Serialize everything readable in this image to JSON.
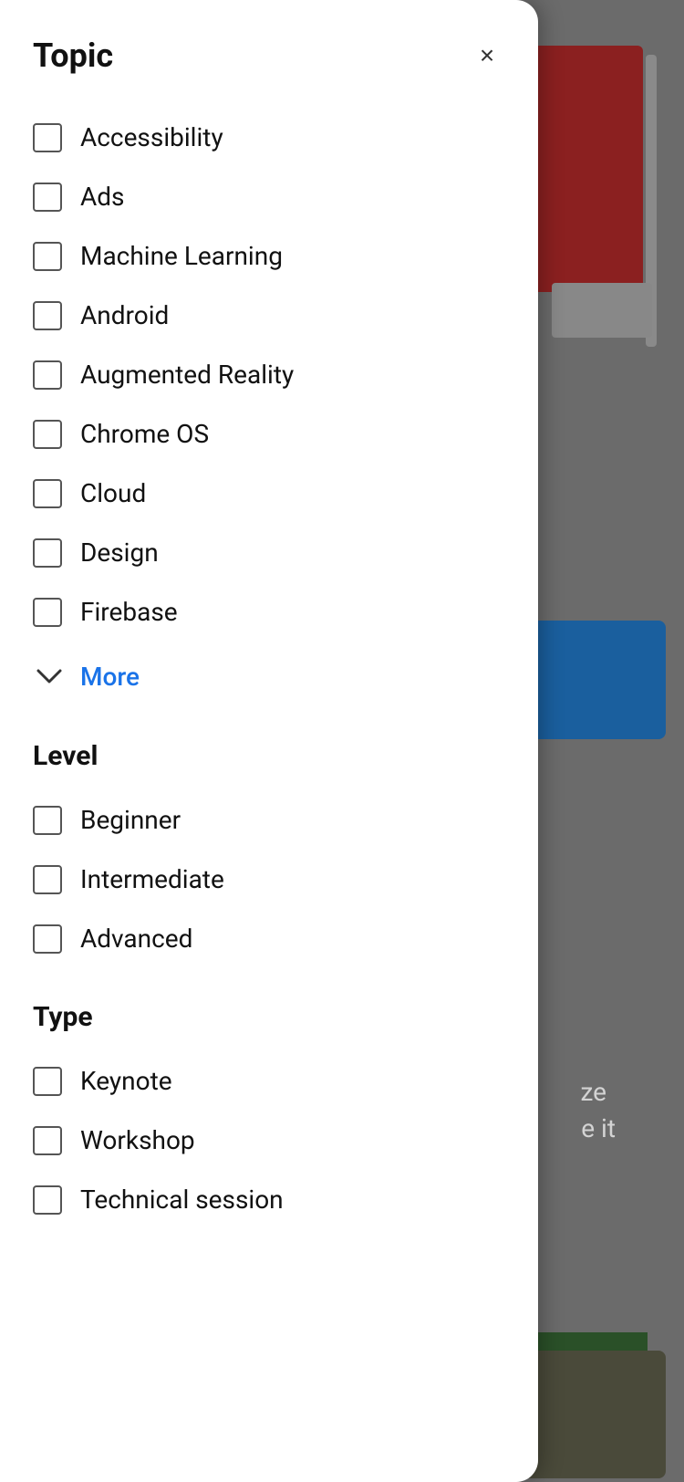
{
  "modal": {
    "title": "Topic",
    "close_label": "×",
    "topic_section": {
      "items": [
        {
          "id": "accessibility",
          "label": "Accessibility",
          "checked": false
        },
        {
          "id": "ads",
          "label": "Ads",
          "checked": false
        },
        {
          "id": "machine-learning",
          "label": "Machine Learning",
          "checked": false
        },
        {
          "id": "android",
          "label": "Android",
          "checked": false
        },
        {
          "id": "augmented-reality",
          "label": "Augmented Reality",
          "checked": false
        },
        {
          "id": "chrome-os",
          "label": "Chrome OS",
          "checked": false
        },
        {
          "id": "cloud",
          "label": "Cloud",
          "checked": false
        },
        {
          "id": "design",
          "label": "Design",
          "checked": false
        },
        {
          "id": "firebase",
          "label": "Firebase",
          "checked": false
        }
      ],
      "more_label": "More",
      "chevron": "⌄"
    },
    "level_section": {
      "label": "Level",
      "items": [
        {
          "id": "beginner",
          "label": "Beginner",
          "checked": false
        },
        {
          "id": "intermediate",
          "label": "Intermediate",
          "checked": false
        },
        {
          "id": "advanced",
          "label": "Advanced",
          "checked": false
        }
      ]
    },
    "type_section": {
      "label": "Type",
      "items": [
        {
          "id": "keynote",
          "label": "Keynote",
          "checked": false
        },
        {
          "id": "workshop",
          "label": "Workshop",
          "checked": false
        },
        {
          "id": "technical-session",
          "label": "Technical session",
          "checked": false
        }
      ]
    }
  },
  "background": {
    "text1": "ze",
    "text2": "e it"
  }
}
